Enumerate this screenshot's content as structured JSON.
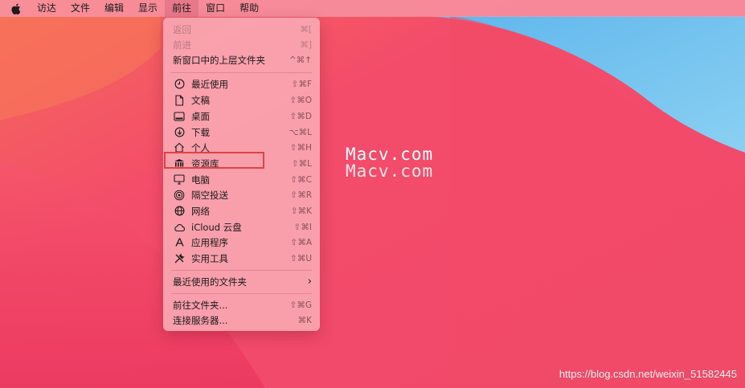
{
  "menubar": {
    "apple_icon": "apple-logo-icon",
    "items": [
      "访达",
      "文件",
      "编辑",
      "显示",
      "前往",
      "窗口",
      "帮助"
    ],
    "active_index": 4
  },
  "go_menu": {
    "back": {
      "label": "返回",
      "shortcut": "⌘["
    },
    "forward": {
      "label": "前进",
      "shortcut": "⌘]"
    },
    "enclosing": {
      "label": "新窗口中的上层文件夹",
      "shortcut": "^⌘↑"
    },
    "recents": {
      "label": "最近使用",
      "shortcut": "⇧⌘F",
      "icon": "clock-icon"
    },
    "documents": {
      "label": "文稿",
      "shortcut": "⇧⌘O",
      "icon": "document-icon"
    },
    "desktop": {
      "label": "桌面",
      "shortcut": "⇧⌘D",
      "icon": "desktop-icon"
    },
    "downloads": {
      "label": "下载",
      "shortcut": "⌥⌘L",
      "icon": "download-icon"
    },
    "home": {
      "label": "个人",
      "shortcut": "⇧⌘H",
      "icon": "home-icon"
    },
    "library": {
      "label": "资源库",
      "shortcut": "⇧⌘L",
      "icon": "library-icon"
    },
    "computer": {
      "label": "电脑",
      "shortcut": "⇧⌘C",
      "icon": "computer-icon"
    },
    "airdrop": {
      "label": "隔空投送",
      "shortcut": "⇧⌘R",
      "icon": "airdrop-icon"
    },
    "network": {
      "label": "网络",
      "shortcut": "⇧⌘K",
      "icon": "network-icon"
    },
    "icloud": {
      "label": "iCloud 云盘",
      "shortcut": "⇧⌘I",
      "icon": "cloud-icon"
    },
    "applications": {
      "label": "应用程序",
      "shortcut": "⇧⌘A",
      "icon": "applications-icon"
    },
    "utilities": {
      "label": "实用工具",
      "shortcut": "⇧⌘U",
      "icon": "utilities-icon"
    },
    "recent_folders": {
      "label": "最近使用的文件夹",
      "icon": "chevron-right-icon"
    },
    "go_to_folder": {
      "label": "前往文件夹...",
      "shortcut": "⇧⌘G"
    },
    "connect_server": {
      "label": "连接服务器...",
      "shortcut": "⌘K"
    }
  },
  "watermark": {
    "top": "Macv.com",
    "bottom": "Macv.com"
  },
  "credit": "https://blog.csdn.net/weixin_51582445",
  "colors": {
    "highlight_box": "#e24141",
    "desktop_base": "#f34c6a",
    "wave_blue": "#6ec2ee"
  }
}
